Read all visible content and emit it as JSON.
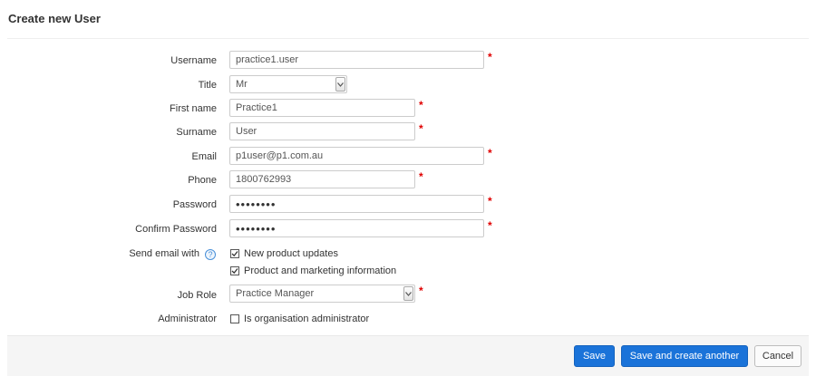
{
  "page": {
    "title": "Create new User"
  },
  "form": {
    "username": {
      "label": "Username",
      "value": "practice1.user"
    },
    "title": {
      "label": "Title",
      "value": "Mr"
    },
    "first_name": {
      "label": "First name",
      "value": "Practice1"
    },
    "surname": {
      "label": "Surname",
      "value": "User"
    },
    "email": {
      "label": "Email",
      "value": "p1user@p1.com.au"
    },
    "phone": {
      "label": "Phone",
      "value": "1800762993"
    },
    "password": {
      "label": "Password",
      "value": "••••••••"
    },
    "confirm_password": {
      "label": "Confirm Password",
      "value": "••••••••"
    },
    "send_email": {
      "label": "Send email with",
      "help_icon": "question-icon",
      "options": [
        {
          "label": "New product updates",
          "checked": true
        },
        {
          "label": "Product and marketing information",
          "checked": true
        }
      ]
    },
    "job_role": {
      "label": "Job Role",
      "value": "Practice Manager"
    },
    "administrator": {
      "label": "Administrator",
      "option_label": "Is organisation administrator",
      "checked": false
    },
    "required_marker": "*"
  },
  "footer": {
    "save_label": "Save",
    "save_another_label": "Save and create another",
    "cancel_label": "Cancel"
  },
  "colors": {
    "primary": "#1a73d9",
    "required": "#e00000",
    "footer_bg": "#f5f5f5"
  }
}
